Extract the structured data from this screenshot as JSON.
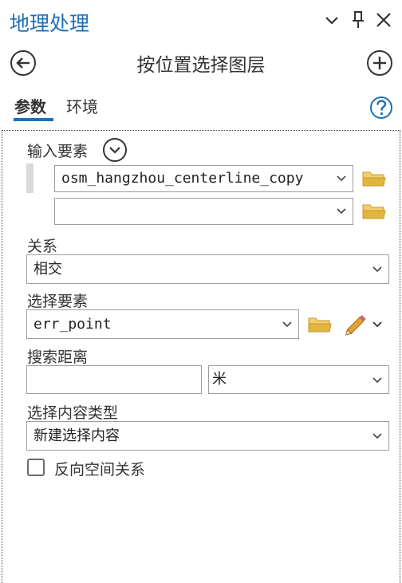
{
  "header": {
    "title": "地理处理",
    "tool_title": "按位置选择图层"
  },
  "tabs": [
    {
      "label": "参数",
      "active": true
    },
    {
      "label": "环境",
      "active": false
    }
  ],
  "params": {
    "input_features": {
      "label": "输入要素",
      "values": [
        "osm_hangzhou_centerline_copy",
        ""
      ]
    },
    "relationship": {
      "label": "关系",
      "value": "相交"
    },
    "selecting_features": {
      "label": "选择要素",
      "value": "err_point"
    },
    "search_distance": {
      "label": "搜索距离",
      "value": "",
      "unit": "米"
    },
    "selection_type": {
      "label": "选择内容类型",
      "value": "新建选择内容"
    },
    "invert": {
      "label": "反向空间关系",
      "checked": false
    }
  },
  "colors": {
    "accent": "#1f6fb7",
    "folder": "#e0b63f"
  }
}
